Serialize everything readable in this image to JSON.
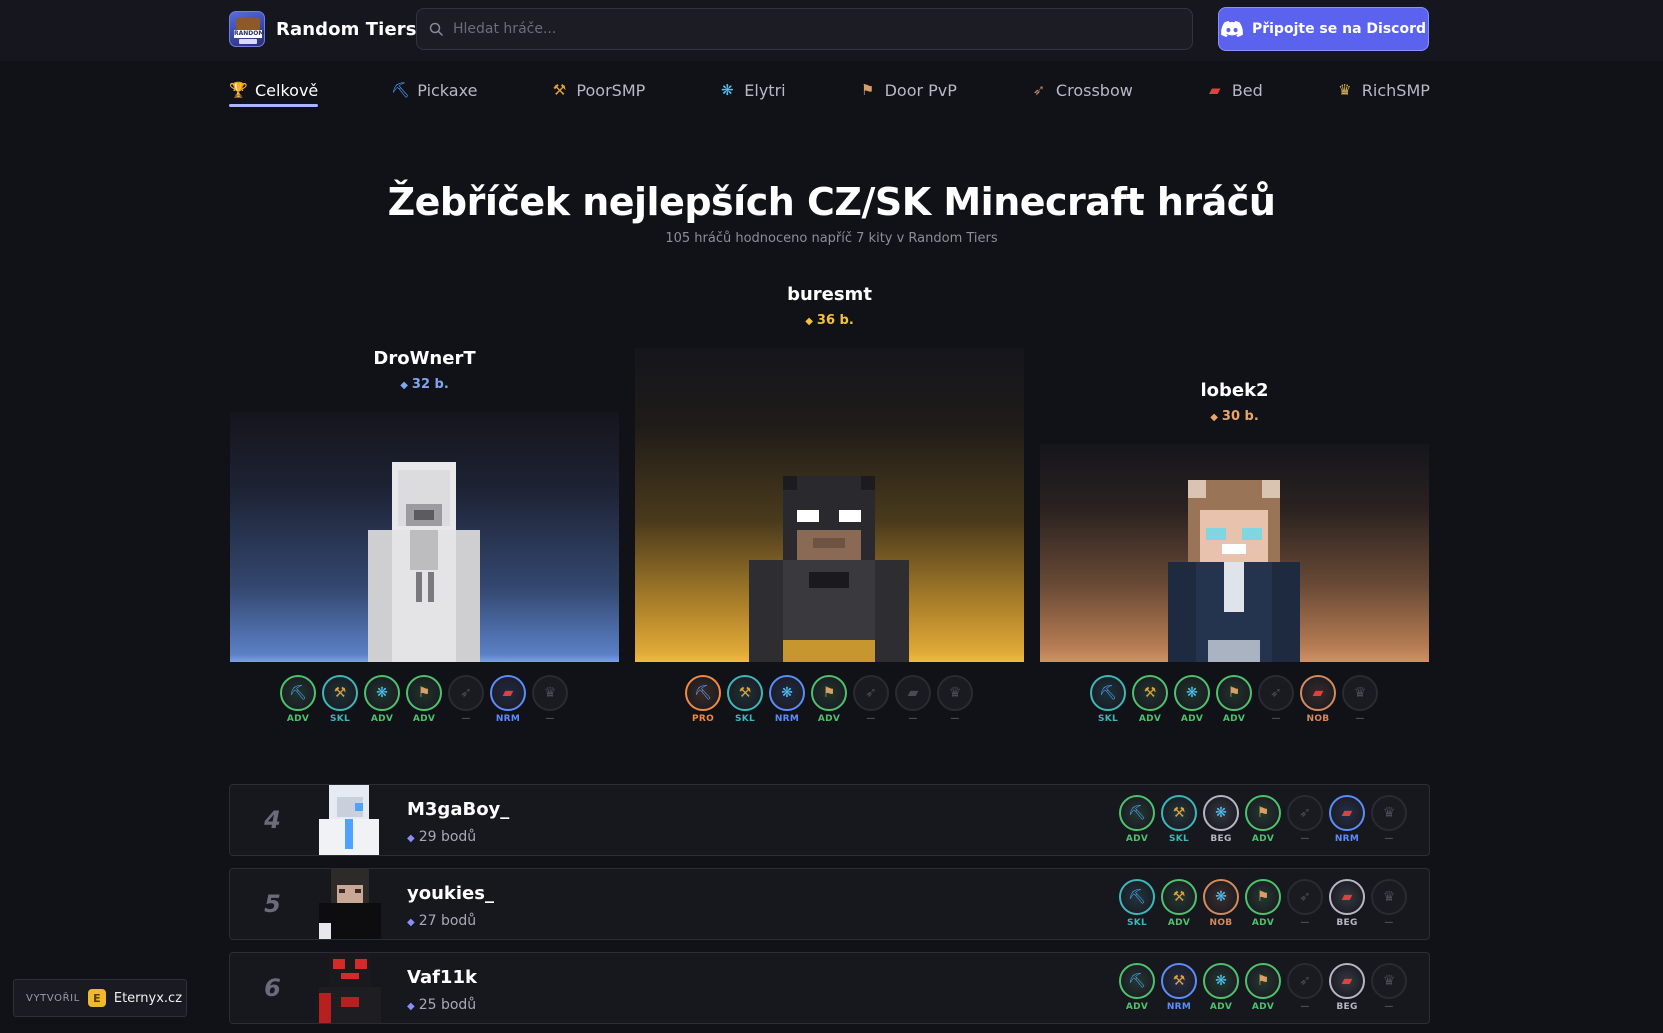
{
  "brand": {
    "name": "Random Tiers",
    "logo_text": "RANDOM",
    "logo_icon": "random-tiers-logo"
  },
  "search": {
    "placeholder": "Hledat hráče...",
    "icon": "search-icon"
  },
  "discord": {
    "label": "Připojte se na Discord",
    "icon": "discord-icon",
    "color": "#5b63ee"
  },
  "tabs": [
    {
      "label": "Celkově",
      "icon": "🏆",
      "active": true
    },
    {
      "label": "Pickaxe",
      "icon": "⛏"
    },
    {
      "label": "PoorSMP",
      "icon": "⚒"
    },
    {
      "label": "Elytri",
      "icon": "❋"
    },
    {
      "label": "Door PvP",
      "icon": "⚑"
    },
    {
      "label": "Crossbow",
      "icon": "➶"
    },
    {
      "label": "Bed",
      "icon": "▰"
    },
    {
      "label": "RichSMP",
      "icon": "♛"
    }
  ],
  "headline": "Žebříček nejlepších CZ/SK Minecraft hráčů",
  "subline": "105 hráčů hodnoceno napříč 7 kity v Random Tiers",
  "kit_icons": [
    "⛏",
    "⚒",
    "❋",
    "⚑",
    "➶",
    "▰",
    "♛"
  ],
  "tier_colors": {
    "PRO": "#f08a3e",
    "ADV": "#4cc36b",
    "SKL": "#3bb8b8",
    "NRM": "#5b8dfa",
    "BEG": "#b6b6c4",
    "NOB": "#d58a5a",
    "—": "#4a4a55"
  },
  "podium": [
    {
      "rank": "1",
      "name": "buresmt",
      "points": "36 b.",
      "rank_color": "#f2c23e",
      "points_color": "#f2c23e",
      "tiers": [
        "PRO",
        "SKL",
        "NRM",
        "ADV",
        "—",
        "—",
        "—"
      ]
    },
    {
      "rank": "2",
      "name": "DroWnerT",
      "points": "32 b.",
      "rank_color": "#8fb2ef",
      "points_color": "#7fa6f0",
      "tiers": [
        "ADV",
        "SKL",
        "ADV",
        "ADV",
        "—",
        "NRM",
        "—"
      ]
    },
    {
      "rank": "3",
      "name": "lobek2",
      "points": "30 b.",
      "rank_color": "#dfa160",
      "points_color": "#e9a766",
      "tiers": [
        "SKL",
        "ADV",
        "ADV",
        "ADV",
        "—",
        "NOB",
        "—"
      ]
    }
  ],
  "list": [
    {
      "rank": "4",
      "name": "M3gaBoy_",
      "points": "29 bodů",
      "tiers": [
        "ADV",
        "SKL",
        "BEG",
        "ADV",
        "—",
        "NRM",
        "—"
      ]
    },
    {
      "rank": "5",
      "name": "youkies_",
      "points": "27 bodů",
      "tiers": [
        "SKL",
        "ADV",
        "NOB",
        "ADV",
        "—",
        "BEG",
        "—"
      ]
    },
    {
      "rank": "6",
      "name": "Vaf11k",
      "points": "25 bodů",
      "tiers": [
        "ADV",
        "NRM",
        "ADV",
        "ADV",
        "—",
        "BEG",
        "—"
      ]
    }
  ],
  "credit": {
    "label": "VYTVOŘIL",
    "name": "Eternyx.cz"
  }
}
